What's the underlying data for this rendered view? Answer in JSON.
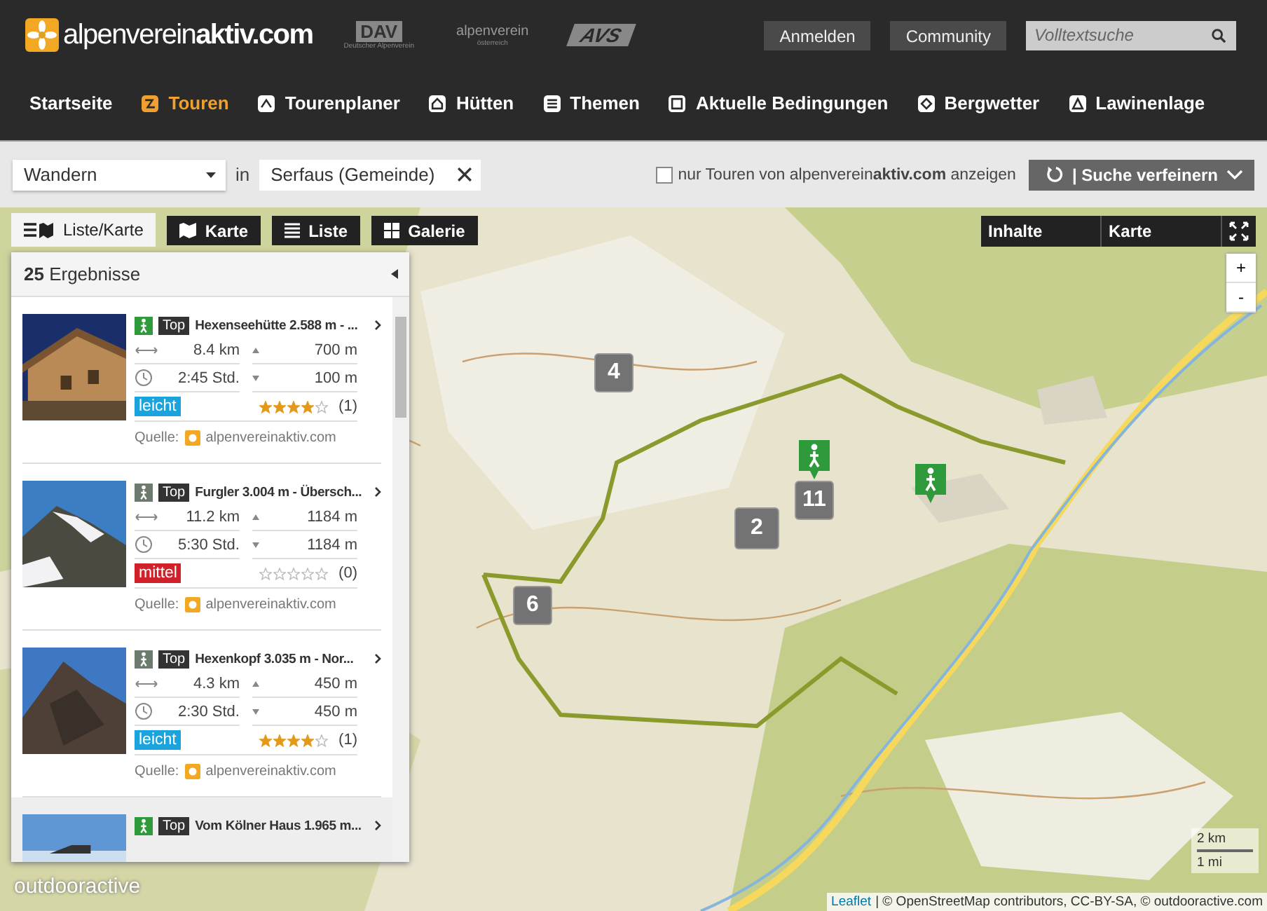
{
  "header": {
    "logo": {
      "light": "alpenverein",
      "bold": "aktiv.com"
    },
    "partners": [
      {
        "name": "DAV",
        "sub": "Deutscher Alpenverein"
      },
      {
        "name": "alpenverein",
        "sub": "österreich"
      },
      {
        "name": "AVS"
      }
    ],
    "buttons": [
      "Anmelden",
      "Community"
    ],
    "search": {
      "placeholder": "Volltextsuche"
    }
  },
  "nav": [
    {
      "label": "Startseite",
      "selected": false
    },
    {
      "label": "Touren",
      "selected": true
    },
    {
      "label": "Tourenplaner",
      "selected": false
    },
    {
      "label": "Hütten",
      "selected": false
    },
    {
      "label": "Themen",
      "selected": false
    },
    {
      "label": "Aktuelle Bedingungen",
      "selected": false
    },
    {
      "label": "Bergwetter",
      "selected": false
    },
    {
      "label": "Lawinenlage",
      "selected": false
    }
  ],
  "filter": {
    "category": "Wandern",
    "connector": "in",
    "location": "Serfaus (Gemeinde)",
    "only_own": {
      "label": "nur Touren von alpenverein**aktiv.com** anzeigen",
      "checked": false
    },
    "refine": "| Suche verfeinern"
  },
  "view_tabs": [
    {
      "label": "Liste/Karte",
      "selected": true
    },
    {
      "label": "Karte",
      "selected": false
    },
    {
      "label": "Liste",
      "selected": false
    },
    {
      "label": "Galerie",
      "selected": false
    }
  ],
  "map_tabs": [
    "Inhalte",
    "Karte"
  ],
  "zoom": [
    "+",
    "-"
  ],
  "results": {
    "count": "25",
    "label": "Ergebnisse",
    "tours": [
      {
        "kind": "hiking",
        "badge": "Top",
        "title": "Hexenseehütte 2.588 m - ...",
        "distance": "8.4 km",
        "ascent": "700 m",
        "duration": "2:45 Std.",
        "descent": "100 m",
        "difficulty": "leicht",
        "color": "#1aa3dc",
        "stars": 4,
        "ratings": "(1)",
        "source_label": "Quelle:",
        "source": "alpenvereinaktiv.com",
        "highlighted": false
      },
      {
        "kind": "climbing",
        "badge": "Top",
        "title": "Furgler 3.004 m - Übersch...",
        "distance": "11.2 km",
        "ascent": "1184 m",
        "duration": "5:30 Std.",
        "descent": "1184 m",
        "difficulty": "mittel",
        "color": "#d0202a",
        "stars": 0,
        "ratings": "(0)",
        "source_label": "Quelle:",
        "source": "alpenvereinaktiv.com",
        "highlighted": false
      },
      {
        "kind": "climbing",
        "badge": "Top",
        "title": "Hexenkopf 3.035 m - Nor...",
        "distance": "4.3 km",
        "ascent": "450 m",
        "duration": "2:30 Std.",
        "descent": "450 m",
        "difficulty": "leicht",
        "color": "#1aa3dc",
        "stars": 4,
        "ratings": "(1)",
        "source_label": "Quelle:",
        "source": "alpenvereinaktiv.com",
        "highlighted": false
      },
      {
        "kind": "hiking",
        "badge": "Top",
        "title": "Vom Kölner Haus 1.965 m...",
        "highlighted": true
      }
    ]
  },
  "clusters": [
    {
      "count": "4"
    },
    {
      "count": "11"
    },
    {
      "count": "2"
    },
    {
      "count": "6"
    }
  ],
  "map_brand": "outdooractive",
  "scale": [
    "2 km",
    "1 mi"
  ],
  "attribution": {
    "link": "Leaflet",
    "text": "| © OpenStreetMap contributors, CC-BY-SA, © outdooractive.com"
  }
}
